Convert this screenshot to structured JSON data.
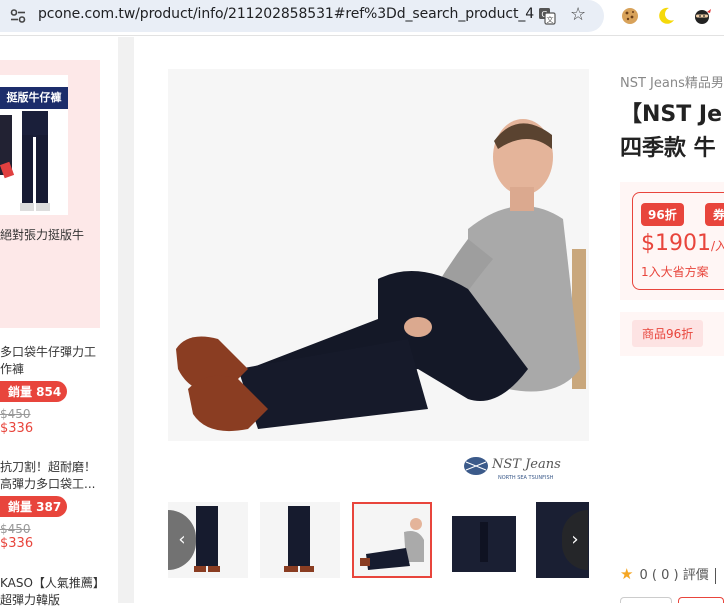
{
  "browser": {
    "url": "pcone.com.tw/product/info/211202858531#ref%3Dd_search_product_4",
    "icons": [
      "tune-icon",
      "translate-icon",
      "star-icon",
      "cookie-icon",
      "moon-icon",
      "ninja-icon"
    ]
  },
  "sidebar": {
    "promo": {
      "banner": "挺版牛仔褲",
      "title": "絕對張力挺版牛"
    },
    "items": [
      {
        "name": "多口袋牛仔彈力工作褲",
        "sold": "銷量 854",
        "orig_price": "$450",
        "price": "$336"
      },
      {
        "name": "抗刀割！超耐磨！高彈力多口袋工...",
        "sold": "銷量 387",
        "orig_price": "$450",
        "price": "$336"
      },
      {
        "name": "KASO【人氣推薦】超彈力韓版"
      }
    ]
  },
  "product": {
    "brand": "NST Jeans精品男",
    "title_line1": "【NST Je",
    "title_line2": "四季款 牛",
    "discount_badge": "96折",
    "coupon_badge": "券",
    "price": "$1901",
    "price_suffix": "/入",
    "plan": "1入大省方案",
    "promo_tag": "商品96折",
    "logo_text": "NST Jeans",
    "logo_sub": "NORTH SEA TSUNFISH",
    "rating_score": "0",
    "rating_count": "( 0 )",
    "rating_label": "評價"
  },
  "colors": {
    "accent": "#e8453c",
    "promo_bg": "#fde8e8",
    "navy": "#1c2d6b"
  }
}
